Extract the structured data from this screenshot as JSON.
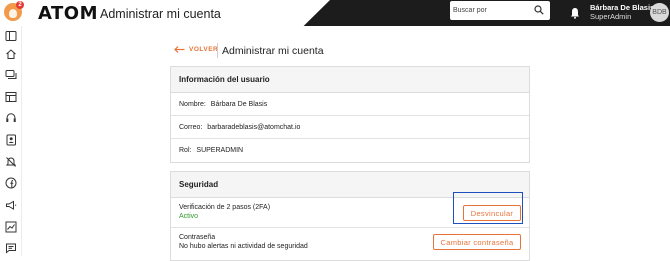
{
  "topbar": {
    "notification_count": "2",
    "brand": "ATOM",
    "app_title": "Administrar mi cuenta",
    "search": {
      "placeholder": "Buscar por"
    },
    "user": {
      "name": "Bárbara De Blasis",
      "role": "SuperAdmin",
      "initials": "BDB"
    }
  },
  "sidebar": {
    "icons": [
      "panel-icon",
      "home-icon",
      "chat-icon",
      "table-icon",
      "headset-icon",
      "contacts-icon",
      "no-notifications-icon",
      "facebook-icon",
      "megaphone-icon",
      "chart-icon",
      "messages-icon"
    ]
  },
  "header": {
    "back_label": "VOLVER",
    "title": "Administrar mi cuenta"
  },
  "user_info": {
    "title": "Información del usuario",
    "name_label": "Nombre:",
    "name_value": "Bárbara De Blasis",
    "email_label": "Correo:",
    "email_value": "barbaradeblasis@atomchat.io",
    "role_label": "Rol:",
    "role_value": "SUPERADMIN"
  },
  "security": {
    "title": "Seguridad",
    "twofa_title": "Verificación de 2 pasos (2FA)",
    "twofa_status": "Activo",
    "unlink_button": "Desvincular",
    "password_title": "Contraseña",
    "password_note": "No hubo alertas ni actividad de seguridad",
    "change_password_button": "Cambiar contraseña"
  },
  "colors": {
    "accent": "#e8733a",
    "topbar": "#1c1c1c",
    "active": "#2e9a2e",
    "focus": "#1f4fbf"
  }
}
